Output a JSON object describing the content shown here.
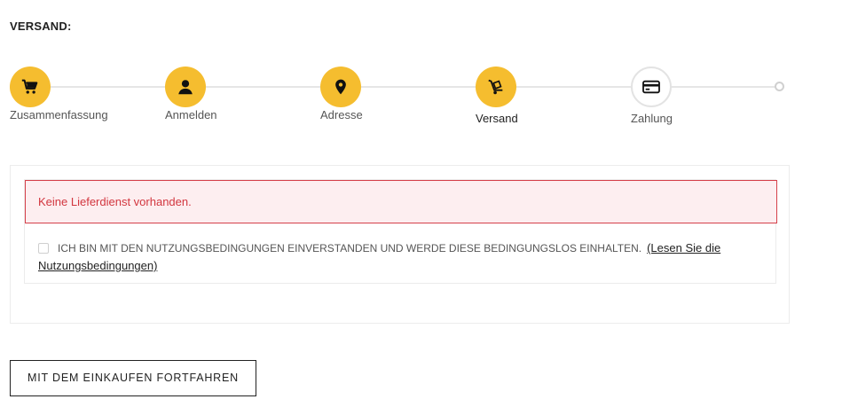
{
  "page": {
    "heading": "VERSAND:"
  },
  "steps": [
    {
      "label": "Zusammenfassung",
      "icon": "cart-icon",
      "active": false
    },
    {
      "label": "Anmelden",
      "icon": "user-icon",
      "active": false
    },
    {
      "label": "Adresse",
      "icon": "map-pin-icon",
      "active": false
    },
    {
      "label": "Versand",
      "icon": "hand-truck-icon",
      "active": true
    },
    {
      "label": "Zahlung",
      "icon": "credit-card-icon",
      "active": false
    }
  ],
  "alert": {
    "message": "Keine Lieferdienst vorhanden."
  },
  "terms": {
    "text": "ICH BIN MIT DEN NUTZUNGSBEDINGUNGEN EINVERSTANDEN UND WERDE DIESE BEDINGUNGSLOS EINHALTEN.",
    "link": "(Lesen Sie die Nutzungsbedingungen)"
  },
  "actions": {
    "continue_label": "MIT DEM EINKAUFEN FORTFAHREN"
  },
  "colors": {
    "accent": "#f5bd2f",
    "error": "#d2363f",
    "error_bg": "#fdeef0"
  }
}
